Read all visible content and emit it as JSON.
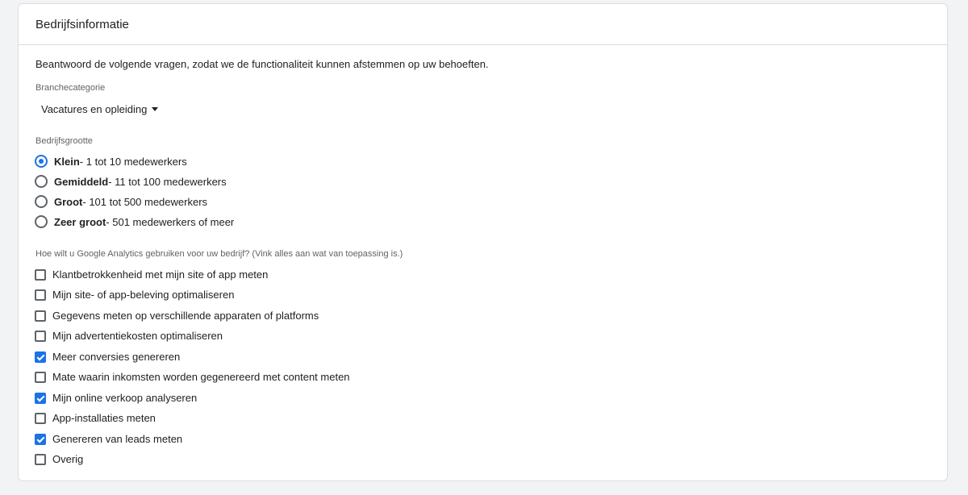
{
  "card": {
    "title": "Bedrijfsinformatie",
    "intro": "Beantwoord de volgende vragen, zodat we de functionaliteit kunnen afstemmen op uw behoeften."
  },
  "industry": {
    "label": "Branchecategorie",
    "selected": "Vacatures en opleiding"
  },
  "size": {
    "label": "Bedrijfsgrootte",
    "options": [
      {
        "name": "Klein",
        "detail": " - 1 tot 10 medewerkers",
        "checked": true
      },
      {
        "name": "Gemiddeld",
        "detail": " - 11 tot 100 medewerkers",
        "checked": false
      },
      {
        "name": "Groot",
        "detail": " - 101 tot 500 medewerkers",
        "checked": false
      },
      {
        "name": "Zeer groot",
        "detail": " - 501 medewerkers of meer",
        "checked": false
      }
    ]
  },
  "usage": {
    "label": "Hoe wilt u Google Analytics gebruiken voor uw bedrijf? (Vink alles aan wat van toepassing is.)",
    "options": [
      {
        "label": "Klantbetrokkenheid met mijn site of app meten",
        "checked": false
      },
      {
        "label": "Mijn site- of app-beleving optimaliseren",
        "checked": false
      },
      {
        "label": "Gegevens meten op verschillende apparaten of platforms",
        "checked": false
      },
      {
        "label": "Mijn advertentiekosten optimaliseren",
        "checked": false
      },
      {
        "label": "Meer conversies genereren",
        "checked": true
      },
      {
        "label": "Mate waarin inkomsten worden gegenereerd met content meten",
        "checked": false
      },
      {
        "label": "Mijn online verkoop analyseren",
        "checked": true
      },
      {
        "label": "App-installaties meten",
        "checked": false
      },
      {
        "label": "Genereren van leads meten",
        "checked": true
      },
      {
        "label": "Overig",
        "checked": false
      }
    ]
  },
  "colors": {
    "accent": "#1a73e8",
    "border": "#dadce0"
  }
}
